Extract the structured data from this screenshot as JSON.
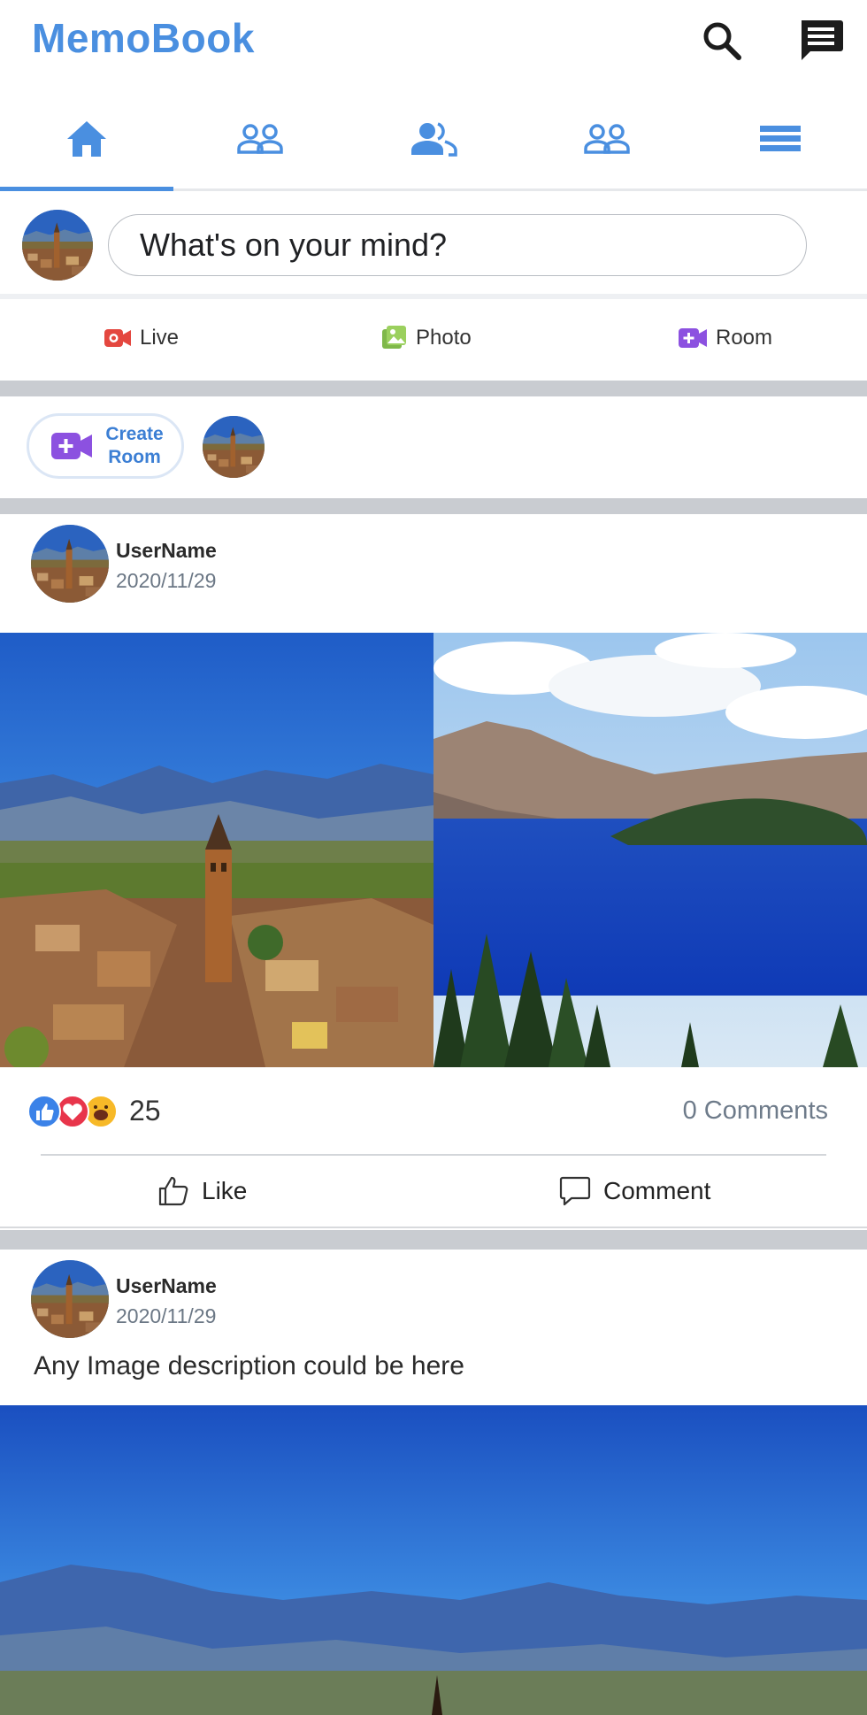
{
  "app": {
    "name": "MemoBook",
    "accent_color": "#4a8fe0"
  },
  "header": {
    "search_icon": "search-icon",
    "messages_icon": "message-icon"
  },
  "tabs": [
    {
      "icon": "home-icon",
      "active": true
    },
    {
      "icon": "friends-icon",
      "active": false
    },
    {
      "icon": "people-icon",
      "active": false
    },
    {
      "icon": "groups-icon",
      "active": false
    },
    {
      "icon": "menu-icon",
      "active": false
    }
  ],
  "composer": {
    "placeholder": "What's on your mind?"
  },
  "quick_actions": {
    "live": "Live",
    "photo": "Photo",
    "room": "Room"
  },
  "rooms": {
    "create_line1": "Create",
    "create_line2": "Room"
  },
  "posts": [
    {
      "username": "UserName",
      "date": "2020/11/29",
      "reaction_count": "25",
      "comments": "0 Comments",
      "like_label": "Like",
      "comment_label": "Comment"
    },
    {
      "username": "UserName",
      "date": "2020/11/29",
      "description": "Any Image description could be here"
    }
  ]
}
